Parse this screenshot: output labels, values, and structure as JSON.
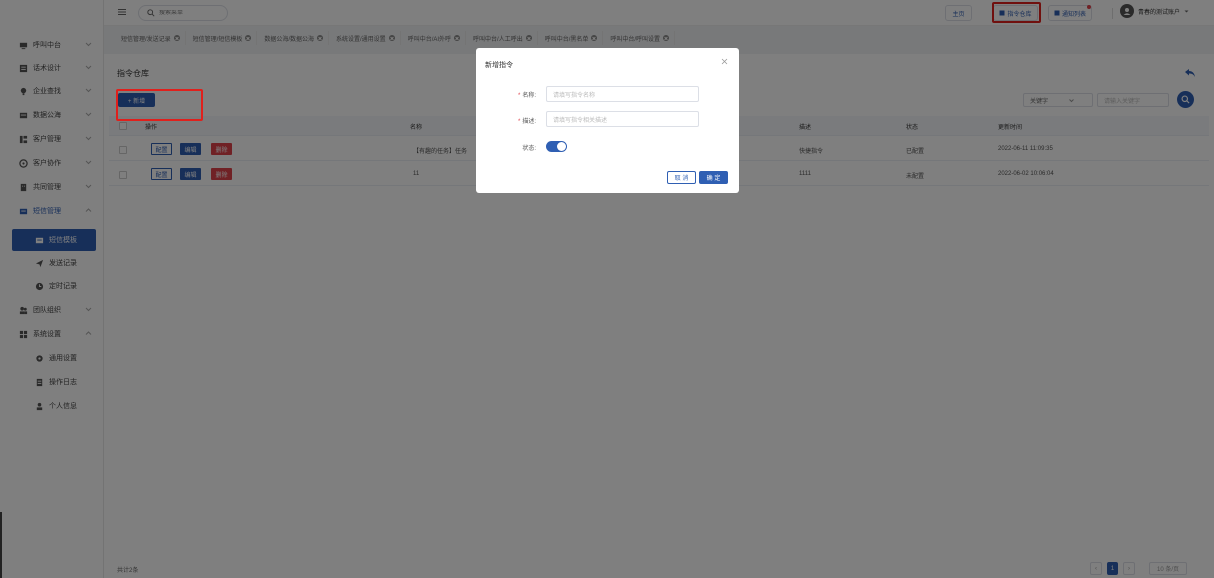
{
  "sidebar": {
    "items": [
      {
        "label": "呼叫中台",
        "icon": "monitor-icon"
      },
      {
        "label": "话术设计",
        "icon": "list-icon"
      },
      {
        "label": "企业查找",
        "icon": "bulb-icon"
      },
      {
        "label": "数据公海",
        "icon": "database-icon"
      },
      {
        "label": "客户管理",
        "icon": "customer-icon"
      },
      {
        "label": "客户协作",
        "icon": "collab-icon"
      },
      {
        "label": "共同管理",
        "icon": "building-icon"
      },
      {
        "label": "短信管理",
        "icon": "sms-icon"
      },
      {
        "label": "短信模板",
        "icon": "template-icon"
      },
      {
        "label": "发送记录",
        "icon": "send-icon"
      },
      {
        "label": "定时记录",
        "icon": "clock-icon"
      },
      {
        "label": "团队组织",
        "icon": "team-icon"
      },
      {
        "label": "系统设置",
        "icon": "grid-icon"
      },
      {
        "label": "通用设置",
        "icon": "gear-icon"
      },
      {
        "label": "操作日志",
        "icon": "log-icon"
      },
      {
        "label": "个人信息",
        "icon": "user-icon"
      }
    ]
  },
  "header": {
    "search_placeholder": "搜索菜单",
    "btn_home": "主页",
    "btn_command_repo": "指令仓库",
    "btn_notify_list": "通知列表",
    "user_name": "青春的测试账户"
  },
  "tags": [
    "短信管理/发送记录",
    "短信管理/短信模板",
    "数据公海/数据公海",
    "系统设置/通用设置",
    "呼叫中台/AI外呼",
    "呼叫中台/人工呼出",
    "呼叫中台/黑名单",
    "呼叫中台/呼叫设置"
  ],
  "main": {
    "title": "指令仓库",
    "add_label": "+ 新增",
    "filter_select": "关键字",
    "filter_placeholder": "请输入关键字",
    "columns": {
      "action": "操作",
      "name": "名称",
      "desc": "描述",
      "status": "状态",
      "updated": "更新时间"
    },
    "btn_config": "配置",
    "btn_edit": "编辑",
    "btn_delete": "删除",
    "rows": [
      {
        "name": "【有趣的任务】任务",
        "desc": "快捷指令",
        "status": "已配置",
        "updated": "2022-06-11 11:09:35"
      },
      {
        "name": "11",
        "desc": "1111",
        "status": "未配置",
        "updated": "2022-06-02 10:06:04"
      }
    ],
    "total": "共计2条",
    "page_current": "1",
    "page_size": "10 条/页"
  },
  "modal": {
    "title": "新增指令",
    "label_name": "名称:",
    "placeholder_name": "请填写指令名称",
    "label_desc": "描述:",
    "placeholder_desc": "请填写指令相关描述",
    "label_status": "状态:",
    "status_on": true,
    "cancel": "取 消",
    "ok": "确 定"
  },
  "colors": {
    "primary": "#2f5fb3",
    "danger": "#e0424b",
    "highlight": "#e0201c"
  }
}
